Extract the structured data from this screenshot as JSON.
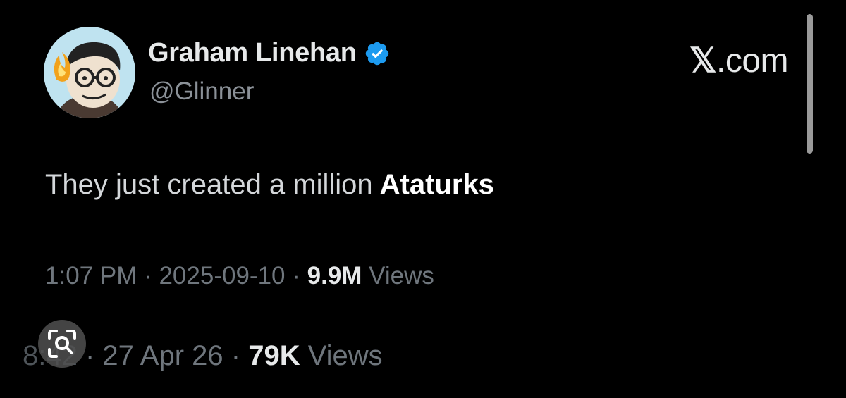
{
  "author": {
    "display_name": "Graham Linehan",
    "handle": "@Glinner",
    "verified": true,
    "avatar_icon": "cartoon-avatar-icon"
  },
  "brand": {
    "label": ".com",
    "glyph": "𝕏"
  },
  "tweet": {
    "text": "They just created a million",
    "emphasis": "Ataturks"
  },
  "meta": {
    "time": "1:07 PM",
    "sep1": " · ",
    "date": "2025-09-10",
    "sep2": " · ",
    "views_count": "9.9M",
    "views_label": " Views"
  },
  "meta_secondary": {
    "time": "8:42",
    "sep1": " · ",
    "date": "27 Apr 26",
    "sep2": " · ",
    "views_count": "79K",
    "views_label": " Views"
  },
  "colors": {
    "background": "#000000",
    "text_primary": "#e7e9ea",
    "text_secondary": "#6f767d",
    "verified_blue": "#1d9bf0"
  }
}
